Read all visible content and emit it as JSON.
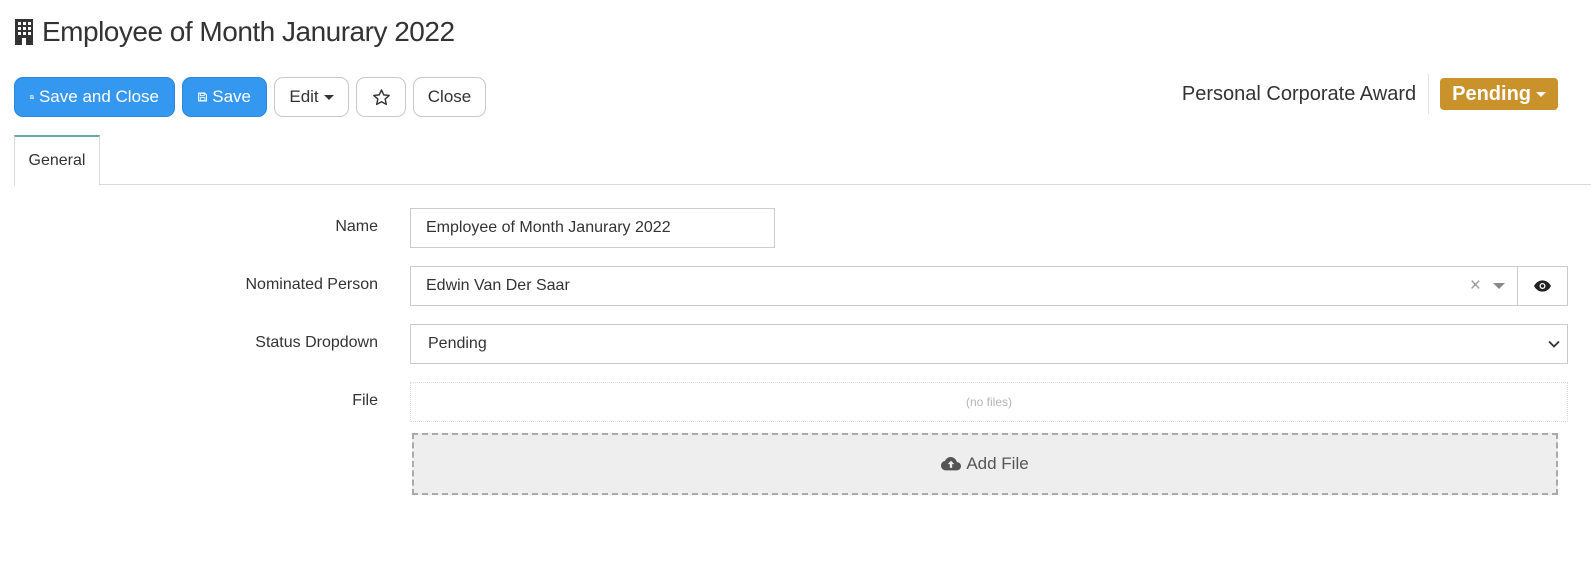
{
  "page": {
    "title": "Employee of Month Janurary 2022",
    "title_icon": "building-icon"
  },
  "toolbar": {
    "save_close_label": "Save and Close",
    "save_label": "Save",
    "edit_label": "Edit",
    "favorite_icon": "star-icon",
    "close_label": "Close"
  },
  "header": {
    "award_type": "Personal Corporate Award",
    "status_label": "Pending",
    "status_color": "#c9922a"
  },
  "tabs": [
    {
      "label": "General",
      "active": true
    }
  ],
  "form": {
    "name": {
      "label": "Name",
      "value": "Employee of Month Janurary 2022"
    },
    "nominated_person": {
      "label": "Nominated Person",
      "value": "Edwin Van Der Saar",
      "clear_symbol": "×"
    },
    "status_dropdown": {
      "label": "Status Dropdown",
      "value": "Pending"
    },
    "file": {
      "label": "File",
      "empty_text": "(no files)",
      "add_label": "Add File"
    }
  },
  "colors": {
    "primary": "#3498f0",
    "status": "#c9922a",
    "tab_accent": "#6aa6a6"
  }
}
